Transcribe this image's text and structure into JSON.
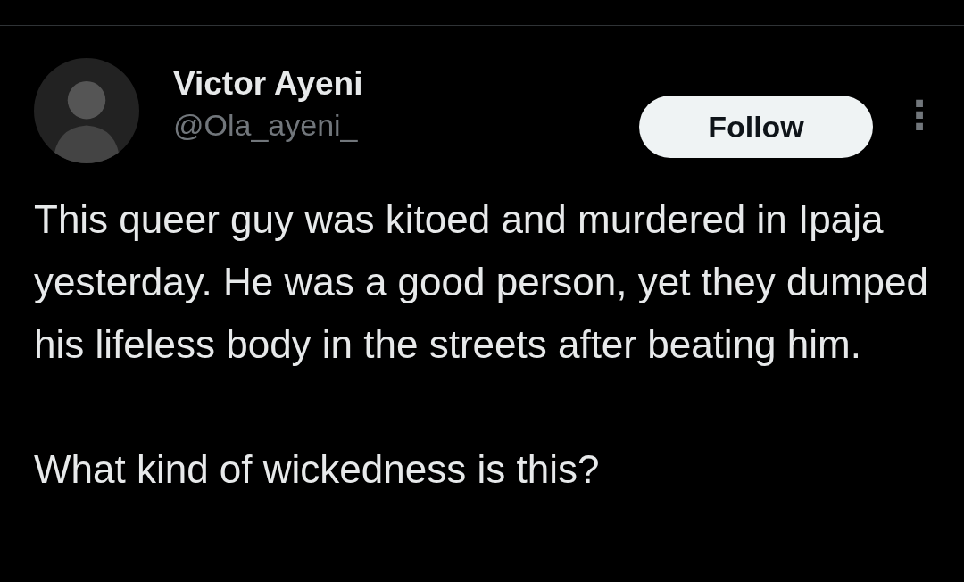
{
  "author": {
    "name": "Victor Ayeni",
    "handle": "@Ola_ayeni_"
  },
  "follow_button": {
    "label": "Follow"
  },
  "more_button": {
    "label": "⋮"
  },
  "paragraphs": [
    "This queer guy was kitoed and murdered in Ipaja yesterday. He was a good person, yet they dumped his lifeless body in the streets after beating him.",
    "What kind of wickedness is this?"
  ]
}
